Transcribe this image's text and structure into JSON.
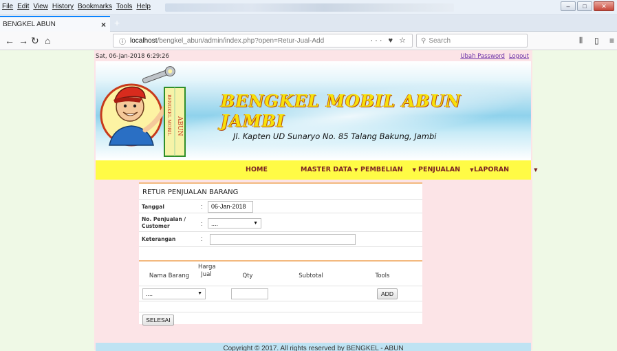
{
  "browser": {
    "menu": [
      "File",
      "Edit",
      "View",
      "History",
      "Bookmarks",
      "Tools",
      "Help"
    ],
    "tab_title": "BENGKEL ABUN",
    "url_host": "localhost",
    "url_path": "/bengkel_abun/admin/index.php?open=Retur-Jual-Add",
    "url_actions": "··· ♥ ☆",
    "search_placeholder": "Search"
  },
  "page": {
    "datetime": "Sat, 06-Jan-2018 6:29:26",
    "links": [
      "Ubah Password",
      "Logout"
    ],
    "site_title": "BENGKEL MOBIL ABUN JAMBI",
    "address": "Jl. Kapten UD Sunaryo No. 85 Talang Bakung, Jambi",
    "logo_sign": "BENGKEL MOBIL",
    "logo_sign2": "ABUN",
    "menu": [
      {
        "label": "HOME",
        "has_dropdown": false
      },
      {
        "label": "MASTER DATA",
        "has_dropdown": true
      },
      {
        "label": "PEMBELIAN",
        "has_dropdown": true
      },
      {
        "label": "PENJUALAN",
        "has_dropdown": true
      },
      {
        "label": "LAPORAN",
        "has_dropdown": true
      }
    ],
    "footer": "Copyright © 2017. All rights reserved by BENGKEL - ABUN"
  },
  "form": {
    "title": "RETUR PENJUALAN BARANG",
    "tanggal_label": "Tanggal",
    "tanggal_value": "06-Jan-2018",
    "penjualan_label": "No. Penjualan / Customer",
    "penjualan_value": "....",
    "keterangan_label": "Keterangan",
    "keterangan_value": "",
    "colon": ":",
    "columns": [
      "Nama Barang",
      "Harga Jual",
      "Qty",
      "Subtotal",
      "Tools"
    ],
    "barang_select": "....",
    "qty_value": "",
    "add_button": "ADD",
    "selesai_button": "SELESAI"
  }
}
